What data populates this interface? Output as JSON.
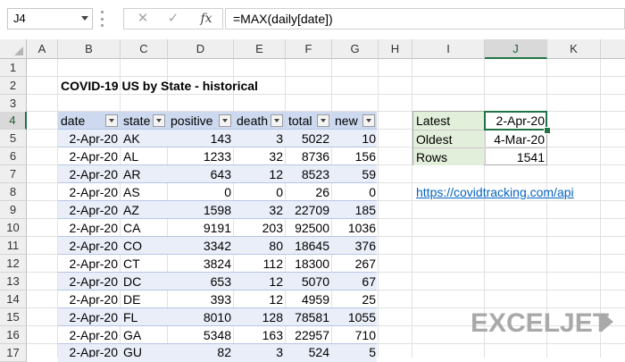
{
  "formula_bar": {
    "name_box": "J4",
    "cancel_icon": "✕",
    "enter_icon": "✓",
    "fx_label": "fx",
    "formula": "=MAX(daily[date])"
  },
  "columns": [
    "A",
    "B",
    "C",
    "D",
    "E",
    "F",
    "G",
    "H",
    "I",
    "J",
    "K"
  ],
  "rows": [
    "1",
    "2",
    "3",
    "4",
    "5",
    "6",
    "7",
    "8",
    "9",
    "10",
    "11",
    "12",
    "13",
    "14",
    "15",
    "16",
    "17"
  ],
  "selected_column": "J",
  "selected_row": "4",
  "title": "COVID-19 US by State - historical",
  "table": {
    "headers": [
      "date",
      "state",
      "positive",
      "death",
      "total",
      "new"
    ],
    "rows": [
      [
        "2-Apr-20",
        "AK",
        "143",
        "3",
        "5022",
        "10"
      ],
      [
        "2-Apr-20",
        "AL",
        "1233",
        "32",
        "8736",
        "156"
      ],
      [
        "2-Apr-20",
        "AR",
        "643",
        "12",
        "8523",
        "59"
      ],
      [
        "2-Apr-20",
        "AS",
        "0",
        "0",
        "26",
        "0"
      ],
      [
        "2-Apr-20",
        "AZ",
        "1598",
        "32",
        "22709",
        "185"
      ],
      [
        "2-Apr-20",
        "CA",
        "9191",
        "203",
        "92500",
        "1036"
      ],
      [
        "2-Apr-20",
        "CO",
        "3342",
        "80",
        "18645",
        "376"
      ],
      [
        "2-Apr-20",
        "CT",
        "3824",
        "112",
        "18300",
        "267"
      ],
      [
        "2-Apr-20",
        "DC",
        "653",
        "12",
        "5070",
        "67"
      ],
      [
        "2-Apr-20",
        "DE",
        "393",
        "12",
        "4959",
        "25"
      ],
      [
        "2-Apr-20",
        "FL",
        "8010",
        "128",
        "78581",
        "1055"
      ],
      [
        "2-Apr-20",
        "GA",
        "5348",
        "163",
        "22957",
        "710"
      ],
      [
        "2-Apr-20",
        "GU",
        "82",
        "3",
        "524",
        "5"
      ]
    ]
  },
  "summary": [
    {
      "label": "Latest",
      "value": "2-Apr-20"
    },
    {
      "label": "Oldest",
      "value": "4-Mar-20"
    },
    {
      "label": "Rows",
      "value": "1541"
    }
  ],
  "link": "https://covidtracking.com/api",
  "logo": {
    "text_a": "EXCELJET",
    "icon": "exceljet-logo"
  }
}
